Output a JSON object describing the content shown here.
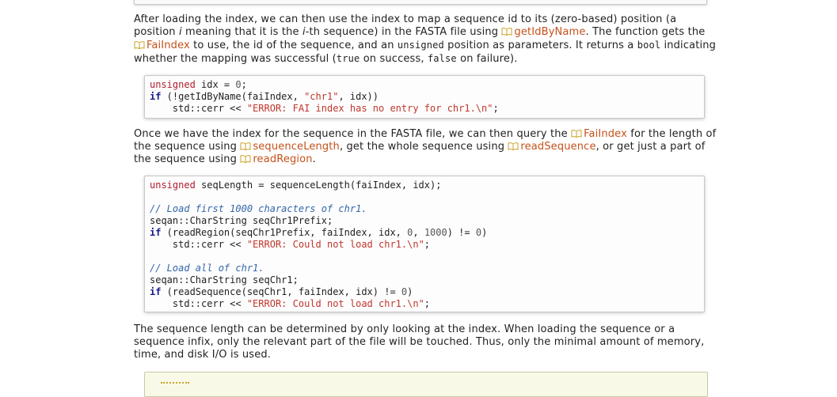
{
  "p1": {
    "t1": "After loading the index, we can then use the index to map a sequence id to its (zero-based) position (a position ",
    "i1": "i",
    "t2": " meaning that it is the ",
    "i2": "i",
    "t3": "-th sequence) in the FASTA file using ",
    "r1": "getIdByName",
    "t4": ". The function gets the ",
    "r2": "FaiIndex",
    "t5": " to use, the id of the sequence, and an ",
    "c1": "unsigned",
    "t6": " position as parameters. It returns a ",
    "c2": "bool",
    "t7": " indicating whether the mapping was successful (",
    "c3": "true",
    "t8": " on success, ",
    "c4": "false",
    "t9": " on failure)."
  },
  "code1": {
    "l1": {
      "a": "unsigned",
      "b": " idx = ",
      "c": "0",
      "d": ";"
    },
    "l2": {
      "a": "if",
      "b": " (!getIdByName(faiIndex, ",
      "c": "\"chr1\"",
      "d": ", idx))"
    },
    "l3": {
      "a": "    std::cerr << ",
      "b": "\"ERROR: FAI index has no entry for chr1.\\n\"",
      "c": ";"
    }
  },
  "p2": {
    "t1": "Once we have the index for the sequence in the FASTA file, we can then query the ",
    "r1": "FaiIndex",
    "t2": " for the length of the sequence using ",
    "r2": "sequenceLength",
    "t3": ", get the whole sequence using ",
    "r3": "readSequence",
    "t4": ", or get just a part of the sequence using ",
    "r4": "readRegion",
    "t5": "."
  },
  "code2": {
    "l1": {
      "a": "unsigned",
      "b": " seqLength = sequenceLength(faiIndex, idx);"
    },
    "l3": "// Load first 1000 characters of chr1.",
    "l4": "seqan::CharString seqChr1Prefix;",
    "l5": {
      "a": "if",
      "b": " (readRegion(seqChr1Prefix, faiIndex, idx, ",
      "c": "0",
      "d": ", ",
      "e": "1000",
      "f": ") != ",
      "g": "0",
      "h": ")"
    },
    "l6": {
      "a": "    std::cerr << ",
      "b": "\"ERROR: Could not load chr1.\\n\"",
      "c": ";"
    },
    "l8": "// Load all of chr1.",
    "l9": "seqan::CharString seqChr1;",
    "l10": {
      "a": "if",
      "b": " (readSequence(seqChr1, faiIndex, idx) != ",
      "c": "0",
      "d": ")"
    },
    "l11": {
      "a": "    std::cerr << ",
      "b": "\"ERROR: Could not load chr1.\\n\"",
      "c": ";"
    }
  },
  "p3": "The sequence length can be determined by only looking at the index. When loading the sequence or a sequence infix, only the relevant part of the file will be touched. Thus, only the minimal amount of memory, time, and disk I/O is used.",
  "colors": {
    "link": "#c5511a",
    "keyword": "#b01c2e",
    "string": "#c0362c",
    "comment": "#3366aa"
  },
  "icons": {
    "ref": "book-icon"
  }
}
